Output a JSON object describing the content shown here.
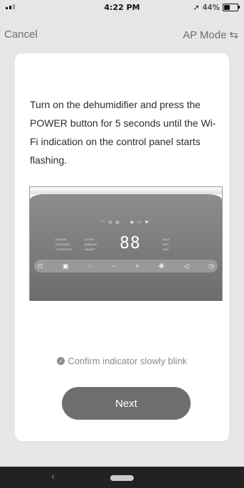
{
  "status_bar": {
    "time": "4:22 PM",
    "battery_text": "44%",
    "battery_level": 0.44,
    "location_icon": "location-arrow-icon"
  },
  "nav": {
    "cancel": "Cancel",
    "mode": "AP Mode",
    "mode_icon": "switch-arrows-icon"
  },
  "instruction": "Turn on the dehumidifier and press the POWER button for 5 seconds until the Wi-Fi indication on the control panel starts flashing.",
  "panel": {
    "digits": "88",
    "left_labels": [
      "DRYER",
      "PURIFIER",
      "COMPLETE"
    ],
    "mid_labels": [
      "SLEEP",
      "MANUAL",
      "SMART"
    ],
    "right_labels": [
      "MAX",
      "MID",
      "MIN"
    ],
    "icons": [
      "power-icon",
      "mode-icon",
      "filter-icon",
      "minus-icon",
      "plus-icon",
      "fan-icon",
      "swing-icon",
      "timer-icon"
    ]
  },
  "confirm": {
    "label": "Confirm indicator slowly blink",
    "icon": "check-circle-icon"
  },
  "next": "Next",
  "colors": {
    "background": "#e6e6e6",
    "card": "#ffffff",
    "button": "#6e6e6e",
    "home_bar": "#222222"
  }
}
